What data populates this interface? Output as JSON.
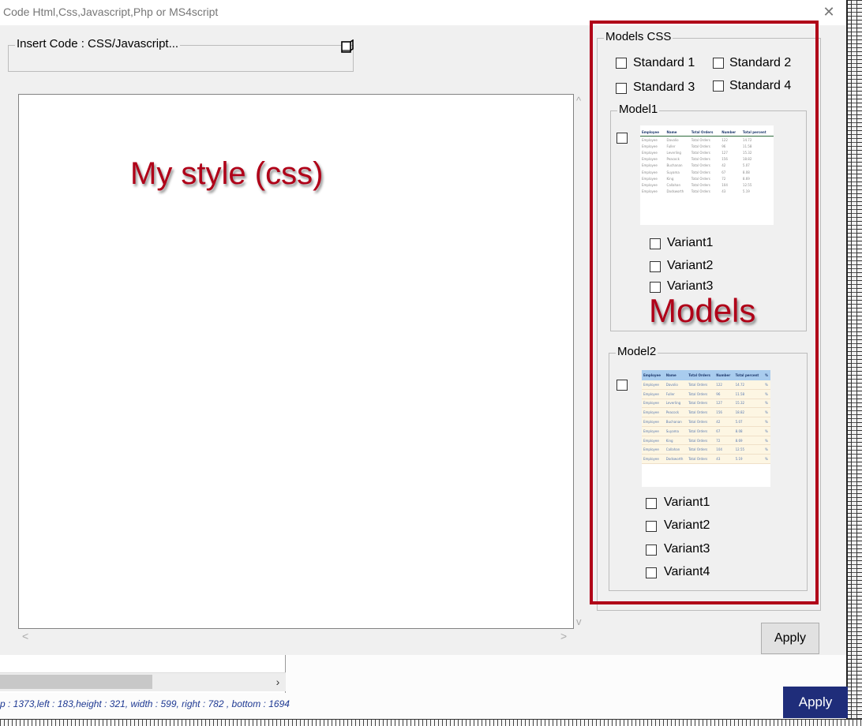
{
  "window": {
    "title": "Code Html,Css,Javascript,Php or MS4script",
    "close_glyph": "✕"
  },
  "code_group": {
    "legend": "Insert Code : CSS/Javascript..."
  },
  "editor": {
    "overlay_label": "My style (css)",
    "scroll_up": "^",
    "scroll_down": "v",
    "scroll_left": "<",
    "scroll_right": ">"
  },
  "models_css": {
    "legend": "Models CSS",
    "standards": [
      {
        "label": "Standard 1",
        "checked": false
      },
      {
        "label": "Standard 2",
        "checked": false
      },
      {
        "label": "Standard 3",
        "checked": false
      },
      {
        "label": "Standard 4",
        "checked": false
      }
    ],
    "overlay_label": "Models",
    "model1": {
      "legend": "Model1",
      "variants": [
        "Variant1",
        "Variant2",
        "Variant3"
      ],
      "table": {
        "headers": [
          "Employee",
          "Name",
          "Total Orders",
          "Number",
          "Total percent"
        ],
        "rows": [
          [
            "Employee",
            "Davolio",
            "Total Orders",
            "122",
            "14.72"
          ],
          [
            "Employee",
            "Fuller",
            "Total Orders",
            "96",
            "11.58"
          ],
          [
            "Employee",
            "Leverling",
            "Total Orders",
            "127",
            "15.32"
          ],
          [
            "Employee",
            "Peacock",
            "Total Orders",
            "156",
            "18.82"
          ],
          [
            "Employee",
            "Buchanan",
            "Total Orders",
            "42",
            "5.07"
          ],
          [
            "Employee",
            "Suyama",
            "Total Orders",
            "67",
            "8.08"
          ],
          [
            "Employee",
            "King",
            "Total Orders",
            "72",
            "8.69"
          ],
          [
            "Employee",
            "Callahan",
            "Total Orders",
            "104",
            "12.55"
          ],
          [
            "Employee",
            "Dodsworth",
            "Total Orders",
            "43",
            "5.19"
          ]
        ]
      }
    },
    "model2": {
      "legend": "Model2",
      "variants": [
        "Variant1",
        "Variant2",
        "Variant3",
        "Variant4"
      ],
      "table": {
        "headers": [
          "Employee",
          "Name",
          "Total Orders",
          "Number",
          "Total percent",
          "%"
        ],
        "rows": [
          [
            "Employee",
            "Davolio",
            "Total Orders",
            "122",
            "14.72",
            "%"
          ],
          [
            "Employee",
            "Fuller",
            "Total Orders",
            "96",
            "11.58",
            "%"
          ],
          [
            "Employee",
            "Leverling",
            "Total Orders",
            "127",
            "15.32",
            "%"
          ],
          [
            "Employee",
            "Peacock",
            "Total Orders",
            "156",
            "18.82",
            "%"
          ],
          [
            "Employee",
            "Buchanan",
            "Total Orders",
            "42",
            "5.07",
            "%"
          ],
          [
            "Employee",
            "Suyama",
            "Total Orders",
            "67",
            "8.08",
            "%"
          ],
          [
            "Employee",
            "King",
            "Total Orders",
            "72",
            "8.69",
            "%"
          ],
          [
            "Employee",
            "Callahan",
            "Total Orders",
            "104",
            "12.55",
            "%"
          ],
          [
            "Employee",
            "Dodsworth",
            "Total Orders",
            "43",
            "5.19",
            "%"
          ]
        ]
      }
    }
  },
  "buttons": {
    "apply": "Apply",
    "bg_apply": "Apply"
  },
  "status": {
    "text": "p : 1373,left : 183,height : 321, width  : 599, right : 782 , bottom : 1694"
  },
  "colors": {
    "accent_red": "#b00018",
    "dialog_bg": "#f0f0f0",
    "bg_apply": "#1f2d7a",
    "model2_header": "#a9ccee",
    "model2_row": "#fdf6e3",
    "model1_header_line": "#2e6b3c"
  }
}
